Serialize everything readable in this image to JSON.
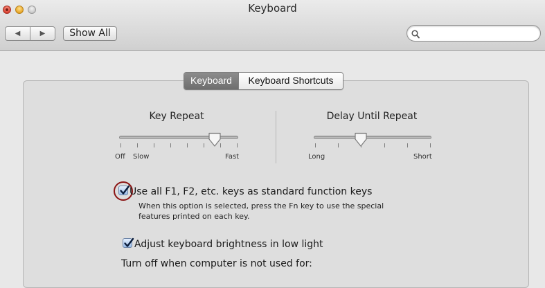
{
  "window": {
    "title": "Keyboard"
  },
  "toolbar": {
    "show_all": "Show All",
    "back_icon": "back-arrow-icon",
    "forward_icon": "forward-arrow-icon"
  },
  "search": {
    "value": "",
    "placeholder": "",
    "icon": "search-icon"
  },
  "tabs": [
    {
      "label": "Keyboard",
      "active": true
    },
    {
      "label": "Keyboard Shortcuts",
      "active": false
    }
  ],
  "key_repeat": {
    "title": "Key Repeat",
    "labels": {
      "off": "Off",
      "slow": "Slow",
      "fast": "Fast"
    },
    "tick_count": 8,
    "value_fraction": 0.8
  },
  "delay_until_repeat": {
    "title": "Delay Until Repeat",
    "labels": {
      "long": "Long",
      "short": "Short"
    },
    "tick_count": 6,
    "value_fraction": 0.4
  },
  "options": {
    "fn_keys": {
      "label": "Use all F1, F2, etc. keys as standard function keys",
      "checked": true,
      "note_line1": "When this option is selected, press the Fn key to use the special",
      "note_line2": "features printed on each key."
    },
    "brightness": {
      "label": "Adjust keyboard brightness in low light",
      "checked": true
    },
    "turn_off_label": "Turn off when computer is not used for:"
  },
  "colors": {
    "highlight_circle": "#8b1515",
    "checkbox_accent": "#4a7bd1"
  }
}
